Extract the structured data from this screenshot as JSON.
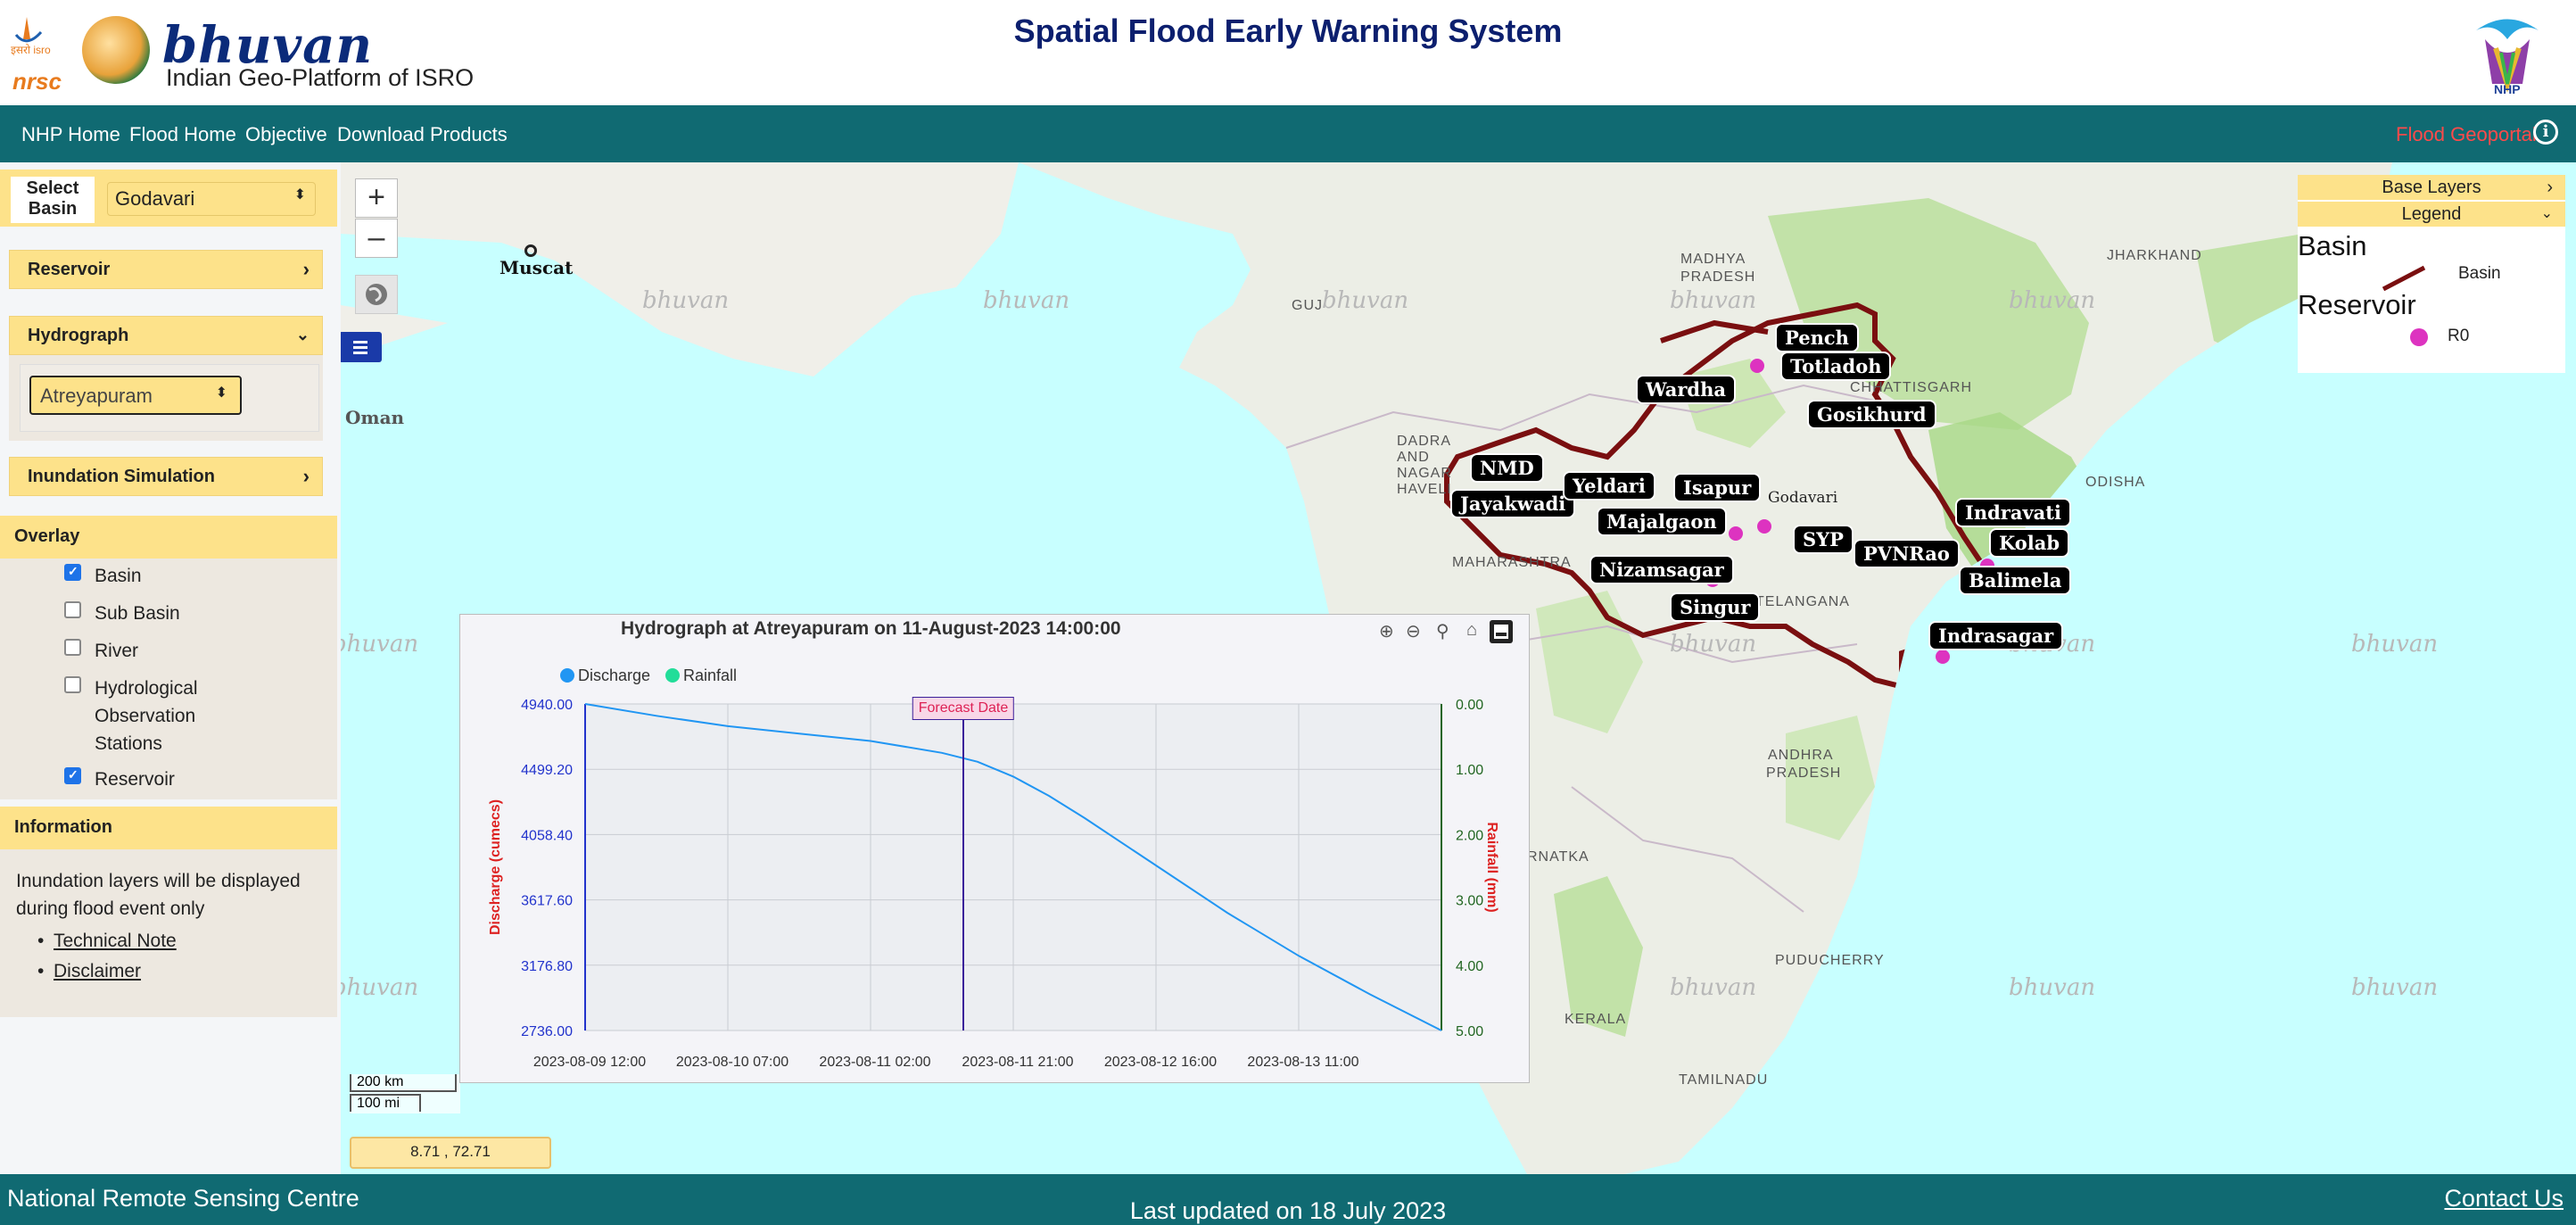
{
  "header": {
    "isro_text": "इसरो isro",
    "nrsc_text": "nrsc",
    "brand": "bhuvan",
    "brand_subtitle": "Indian Geo-Platform of ISRO",
    "title": "Spatial Flood Early Warning System",
    "nhp_text": "NHP"
  },
  "nav": {
    "items": [
      "NHP Home",
      "Flood Home",
      "Objective",
      "Download Products"
    ],
    "geoportal": "Flood Geoportal"
  },
  "sidebar": {
    "select_basin_label": "Select Basin",
    "select_basin_line1": "Select",
    "select_basin_line2": "Basin",
    "basin_value": "Godavari",
    "reservoir": "Reservoir",
    "hydrograph": "Hydrograph",
    "station_value": "Atreyapuram",
    "inundation": "Inundation Simulation",
    "overlay": "Overlay",
    "overlay_items": [
      {
        "label": "Basin",
        "checked": true
      },
      {
        "label": "Sub Basin",
        "checked": false
      },
      {
        "label": "River",
        "checked": false
      },
      {
        "label": "Hydrological Observation Stations",
        "line1": "Hydrological",
        "line2": "Observation",
        "line3": "Stations",
        "checked": false
      },
      {
        "label": "Reservoir",
        "checked": true
      }
    ],
    "information": "Information",
    "info_text_1": "Inundation layers will be displayed",
    "info_text_2": "during flood event only",
    "links": [
      "Technical Note",
      "Disclaimer"
    ]
  },
  "map": {
    "zoom_in": "+",
    "zoom_out": "–",
    "watermark": "bhuvan",
    "places": {
      "muscat": "Muscat",
      "oman": "Oman",
      "madhya_pradesh_1": "MADHYA",
      "madhya_pradesh_2": "PRADESH",
      "jharkhand": "JHARKHAND",
      "guj": "GUJ",
      "chhattisgarh": "CHHATTISGARH",
      "dadra_1": "DADRA",
      "dadra_2": "AND",
      "dadra_3": "NAGAR",
      "dadra_4": "HAVELI",
      "maharashtra": "MAHARASHTRA",
      "odisha": "ODISHA",
      "godavari": "Godavari",
      "telangana": "TELANGANA",
      "andhra_1": "ANDHRA",
      "andhra_2": "PRADESH",
      "karnataka": "RNATKA",
      "kerala": "KERALA",
      "puducherry": "PUDUCHERRY",
      "tamilnadu": "TAMILNADU"
    },
    "reservoirs": [
      "Pench",
      "Totladoh",
      "Wardha",
      "Gosikhurd",
      "NMD",
      "Jayakwadi",
      "Yeldari",
      "Isapur",
      "Majalgaon",
      "SYP",
      "PVNRao",
      "Indravati",
      "Kolab",
      "Nizamsagar",
      "Balimela",
      "Singur",
      "Indrasagar"
    ],
    "scale_km": "200 km",
    "scale_mi": "100 mi",
    "coordinates": "8.71 , 72.71"
  },
  "chart_data": {
    "type": "line",
    "title": "Hydrograph at Atreyapuram on 11-August-2023 14:00:00",
    "legend": [
      "Discharge",
      "Rainfall"
    ],
    "colors": {
      "discharge": "#2196f3",
      "rainfall": "#22dd99",
      "forecast": "#3a1f9a"
    },
    "xlabel": "",
    "ylabel": "Discharge (cumecs)",
    "y2label": "Rainfall (mm)",
    "x_ticks": [
      "2023-08-09 12:00",
      "2023-08-10 07:00",
      "2023-08-11 02:00",
      "2023-08-11 21:00",
      "2023-08-12 16:00",
      "2023-08-13 11:00"
    ],
    "y_ticks": [
      "4940.00",
      "4499.20",
      "4058.40",
      "3617.60",
      "3176.80",
      "2736.00"
    ],
    "y2_ticks": [
      "0.00",
      "1.00",
      "2.00",
      "3.00",
      "4.00",
      "5.00"
    ],
    "ylim": [
      2736,
      4940
    ],
    "y2lim": [
      0,
      5
    ],
    "x_range_hours": [
      0,
      120
    ],
    "forecast_label": "Forecast Date",
    "forecast_at_hour": 53,
    "series": [
      {
        "name": "Discharge",
        "x_hours": [
          0,
          10,
          20,
          30,
          40,
          50,
          55,
          60,
          65,
          70,
          80,
          90,
          100,
          110,
          120
        ],
        "values": [
          4940,
          4860,
          4790,
          4740,
          4690,
          4610,
          4550,
          4450,
          4320,
          4170,
          3850,
          3530,
          3240,
          2980,
          2736
        ]
      }
    ]
  },
  "legend_panel": {
    "base_layers": "Base Layers",
    "legend": "Legend",
    "basin_title": "Basin",
    "basin_item": "Basin",
    "reservoir_title": "Reservoir",
    "reservoir_item": "R0"
  },
  "footer": {
    "left": "National Remote Sensing Centre",
    "center": "Last updated on 18 July 2023",
    "right": "Contact Us"
  }
}
